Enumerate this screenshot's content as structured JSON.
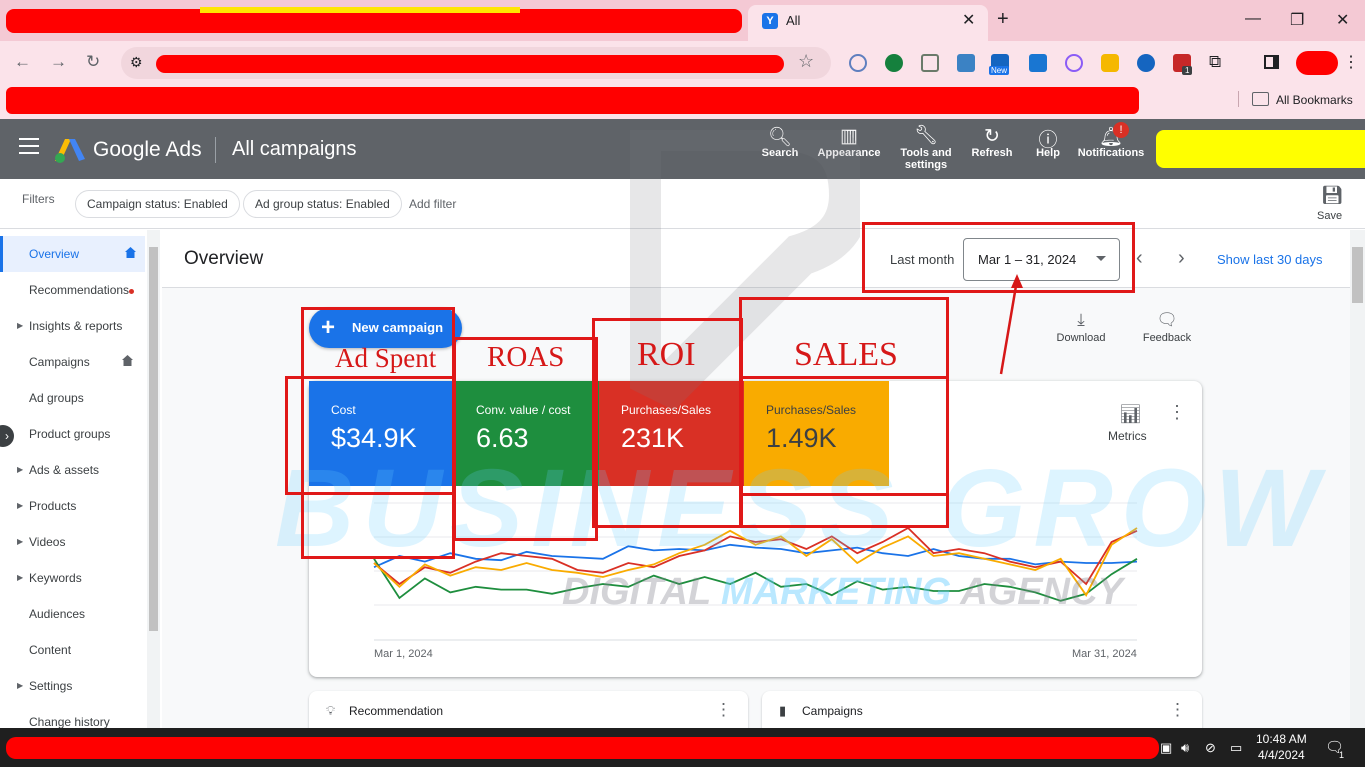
{
  "browser": {
    "tab_title": "All",
    "bookmarks_label": "All Bookmarks",
    "new_extension_badge": "New",
    "extension_count_badge": "1"
  },
  "header": {
    "product_name": "Google Ads",
    "section_title": "All campaigns",
    "tools": [
      {
        "label": "Search",
        "icon": "search-icon"
      },
      {
        "label": "Appearance",
        "icon": "appearance-icon"
      },
      {
        "label": "Tools and settings",
        "icon": "wrench-icon"
      },
      {
        "label": "Refresh",
        "icon": "refresh-icon"
      },
      {
        "label": "Help",
        "icon": "help-icon"
      },
      {
        "label": "Notifications",
        "icon": "bell-icon"
      }
    ],
    "notification_badge": "!"
  },
  "filters": {
    "label": "Filters",
    "chips": [
      "Campaign status: Enabled",
      "Ad group status: Enabled"
    ],
    "add_filter": "Add filter",
    "save_label": "Save"
  },
  "sidebar": {
    "items": [
      {
        "label": "Overview",
        "caret": false,
        "home": true,
        "active": true
      },
      {
        "label": "Recommendations",
        "caret": false,
        "home": false
      },
      {
        "label": "Insights & reports",
        "caret": true,
        "home": false
      },
      {
        "label": "Campaigns",
        "caret": false,
        "home": true
      },
      {
        "label": "Ad groups",
        "caret": false,
        "home": false
      },
      {
        "label": "Product groups",
        "caret": false,
        "home": false
      },
      {
        "label": "Ads & assets",
        "caret": true,
        "home": false
      },
      {
        "label": "Products",
        "caret": true,
        "home": false
      },
      {
        "label": "Videos",
        "caret": true,
        "home": false
      },
      {
        "label": "Keywords",
        "caret": true,
        "home": false
      },
      {
        "label": "Audiences",
        "caret": false,
        "home": false
      },
      {
        "label": "Content",
        "caret": false,
        "home": false
      },
      {
        "label": "Settings",
        "caret": true,
        "home": false
      },
      {
        "label": "Change history",
        "caret": false,
        "home": false
      }
    ]
  },
  "overview": {
    "title": "Overview",
    "range_label": "Last month",
    "range_value": "Mar 1 – 31, 2024",
    "show_last": "Show last 30 days",
    "new_campaign": "New campaign",
    "download": "Download",
    "feedback": "Feedback",
    "metrics_label": "Metrics",
    "tiles": [
      {
        "label": "Cost",
        "value": "$34.9K",
        "color": "#1a73e8"
      },
      {
        "label": "Conv. value / cost",
        "value": "6.63",
        "color": "#1e8e3e"
      },
      {
        "label": "Purchases/Sales",
        "value": "231K",
        "color": "#d93025"
      },
      {
        "label": "Purchases/Sales",
        "value": "1.49K",
        "color": "#f9ab00"
      }
    ],
    "x_start": "Mar 1, 2024",
    "x_end": "Mar 31, 2024"
  },
  "cards": {
    "recommendation": "Recommendation",
    "campaigns": "Campaigns"
  },
  "annotations": {
    "ad_spent": "Ad Spent",
    "roas": "ROAS",
    "roi": "ROI",
    "sales": "SALES"
  },
  "watermark": {
    "line1": "BUSINESS GROW",
    "line2a": "DIGITAL ",
    "line2b": "MARKETING",
    "line2c": " AGENCY"
  },
  "taskbar": {
    "time": "10:48 AM",
    "date": "4/4/2024",
    "notification_count": "1"
  },
  "chart_data": {
    "type": "line",
    "x": [
      "Mar 1, 2024",
      "Mar 2",
      "Mar 3",
      "Mar 4",
      "Mar 5",
      "Mar 6",
      "Mar 7",
      "Mar 8",
      "Mar 9",
      "Mar 10",
      "Mar 11",
      "Mar 12",
      "Mar 13",
      "Mar 14",
      "Mar 15",
      "Mar 16",
      "Mar 17",
      "Mar 18",
      "Mar 19",
      "Mar 20",
      "Mar 21",
      "Mar 22",
      "Mar 23",
      "Mar 24",
      "Mar 25",
      "Mar 26",
      "Mar 27",
      "Mar 28",
      "Mar 29",
      "Mar 30",
      "Mar 31, 2024"
    ],
    "ylim": [
      0,
      100
    ],
    "series": [
      {
        "color": "#1a73e8",
        "values": [
          52,
          60,
          56,
          62,
          58,
          57,
          63,
          60,
          59,
          58,
          67,
          64,
          65,
          64,
          68,
          66,
          65,
          62,
          64,
          66,
          62,
          60,
          65,
          60,
          58,
          58,
          54,
          56,
          55,
          55,
          56
        ]
      },
      {
        "color": "#1e8e3e",
        "values": [
          58,
          30,
          44,
          34,
          38,
          36,
          36,
          33,
          37,
          40,
          38,
          46,
          40,
          45,
          40,
          48,
          38,
          40,
          32,
          42,
          36,
          38,
          35,
          35,
          40,
          38,
          34,
          28,
          33,
          47,
          58
        ]
      },
      {
        "color": "#d93025",
        "values": [
          55,
          40,
          52,
          48,
          56,
          62,
          60,
          58,
          50,
          48,
          55,
          52,
          60,
          64,
          74,
          70,
          72,
          65,
          74,
          62,
          70,
          80,
          62,
          65,
          62,
          56,
          52,
          56,
          40,
          70,
          78
        ]
      },
      {
        "color": "#f9ab00",
        "values": [
          55,
          38,
          54,
          46,
          52,
          50,
          55,
          50,
          48,
          45,
          50,
          54,
          62,
          68,
          78,
          68,
          74,
          60,
          72,
          55,
          66,
          74,
          60,
          62,
          58,
          54,
          50,
          58,
          32,
          68,
          80
        ]
      }
    ]
  }
}
